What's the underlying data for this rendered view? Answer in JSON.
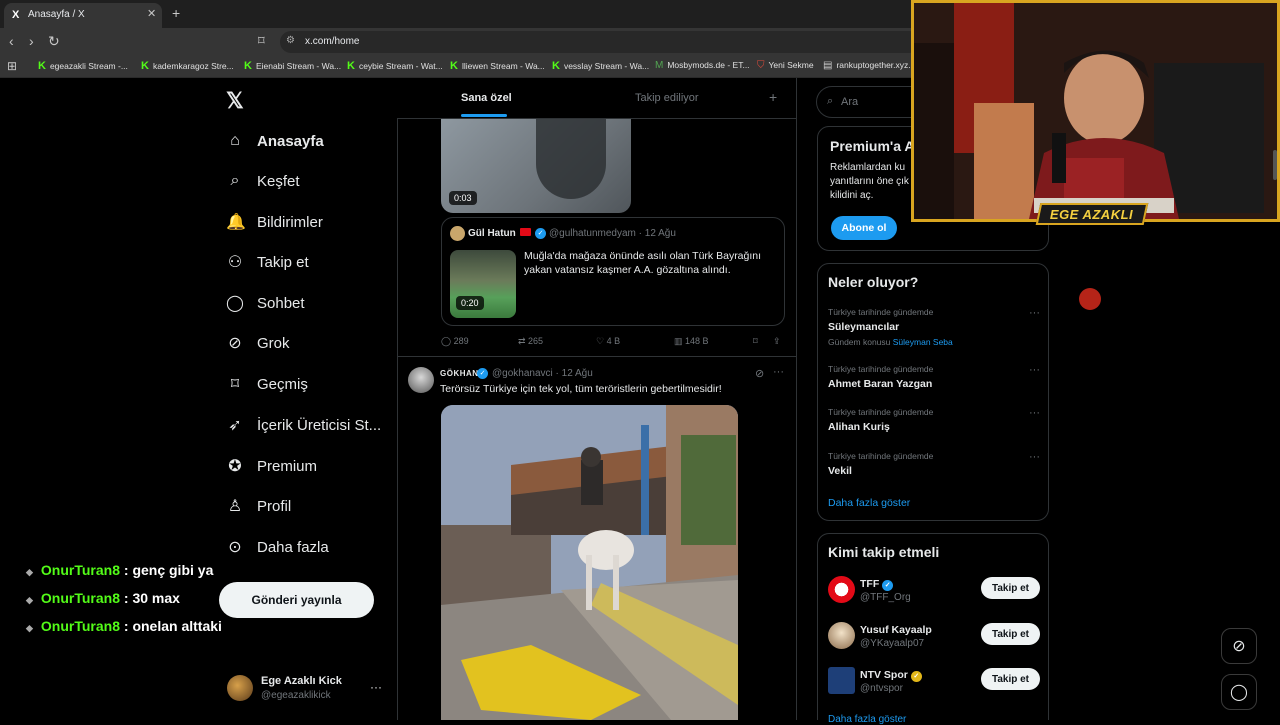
{
  "browser": {
    "tab_title": "Anasayfa / X",
    "tab_favicon": "X",
    "url": "x.com/home",
    "bookmarks": [
      {
        "label": "egeazakli Stream -...",
        "icon": "kick"
      },
      {
        "label": "kademkaragoz Stre...",
        "icon": "kick"
      },
      {
        "label": "Eienabi Stream - Wa...",
        "icon": "kick"
      },
      {
        "label": "ceybie Stream - Wat...",
        "icon": "kick"
      },
      {
        "label": "lliewen Stream - Wa...",
        "icon": "kick"
      },
      {
        "label": "vesslay Stream - Wa...",
        "icon": "kick"
      },
      {
        "label": "Mosbymods.de - ET...",
        "icon": "m-icon"
      },
      {
        "label": "Yeni Sekme",
        "icon": "shield-icon"
      },
      {
        "label": "rankuptogether.xyz...",
        "icon": "page-icon"
      }
    ]
  },
  "nav": {
    "logo": "𝕏",
    "items": [
      {
        "label": "Anasayfa",
        "icon": "⌂"
      },
      {
        "label": "Keşfet",
        "icon": "⌕"
      },
      {
        "label": "Bildirimler",
        "icon": "🔔"
      },
      {
        "label": "Takip et",
        "icon": "⚇"
      },
      {
        "label": "Sohbet",
        "icon": "◯"
      },
      {
        "label": "Grok",
        "icon": "⊘"
      },
      {
        "label": "Geçmiş",
        "icon": "⌑"
      },
      {
        "label": "İçerik Üreticisi St...",
        "icon": "➶"
      },
      {
        "label": "Premium",
        "icon": "✪"
      },
      {
        "label": "Profil",
        "icon": "♙"
      },
      {
        "label": "Daha fazla",
        "icon": "⊙"
      }
    ],
    "post_button": "Gönderi yayınla",
    "profile_name": "Ege Azaklı Kick",
    "profile_handle": "@egeazaklikick",
    "profile_more": "···"
  },
  "chat": [
    {
      "user": "OnurTuran8",
      "message": ": genç gibi ya"
    },
    {
      "user": "OnurTuran8",
      "message": ": 30 max"
    },
    {
      "user": "OnurTuran8",
      "message": ": onelan alttaki"
    }
  ],
  "feed": {
    "tab_foryou": "Sana özel",
    "tab_following": "Takip ediliyor",
    "tab_plus": "+",
    "tweet1": {
      "video_duration": "0:03",
      "quote": {
        "name": "Gül Hatun",
        "handle": "@gulhatunmedyam · 12 Ağu",
        "text": "Muğla'da mağaza önünde asılı olan Türk Bayrağını yakan vatansız kaşmer A.A. gözaltına alındı.",
        "video_duration": "0:20"
      },
      "actions": {
        "replies": "289",
        "reposts": "265",
        "likes": "4 B",
        "views": "148 B"
      }
    },
    "tweet2": {
      "name": "GÖKHAN",
      "handle": "@gokhanavci · 12 Ağu",
      "text": "Terörsüz Türkiye için tek yol, tüm teröristlerin gebertilmesidir!"
    }
  },
  "right": {
    "search_placeholder": "Ara",
    "premium": {
      "title": "Premium'a A",
      "desc": "Reklamlardan ku yanıtlarını öne çık kilidini aç.",
      "button": "Abone ol"
    },
    "trends_title": "Neler oluyor?",
    "trends": [
      {
        "context": "Türkiye tarihinde gündemde",
        "name": "Süleymancılar",
        "extra_prefix": "Gündem konusu",
        "extra_link": "Süleyman Seba"
      },
      {
        "context": "Türkiye tarihinde gündemde",
        "name": "Ahmet Baran Yazgan"
      },
      {
        "context": "Türkiye tarihinde gündemde",
        "name": "Alihan Kuriş"
      },
      {
        "context": "Türkiye tarihinde gündemde",
        "name": "Vekil"
      }
    ],
    "trends_more": "Daha fazla göster",
    "follow_title": "Kimi takip etmeli",
    "follow": [
      {
        "name": "TFF",
        "handle": "@TFF_Org",
        "button": "Takip et",
        "verified_color": "#1d9bf0"
      },
      {
        "name": "Yusuf Kayaalp",
        "handle": "@YKayaalp07",
        "button": "Takip et"
      },
      {
        "name": "NTV Spor",
        "handle": "@ntvspor",
        "button": "Takip et",
        "verified_color": "#e2b719"
      }
    ],
    "follow_more": "Daha fazla göster"
  },
  "streamer": {
    "name": "EGE AZAKLI"
  },
  "colors": {
    "accent": "#1d9bf0",
    "kick_green": "#53fc18",
    "cam_border": "#d9a520"
  }
}
